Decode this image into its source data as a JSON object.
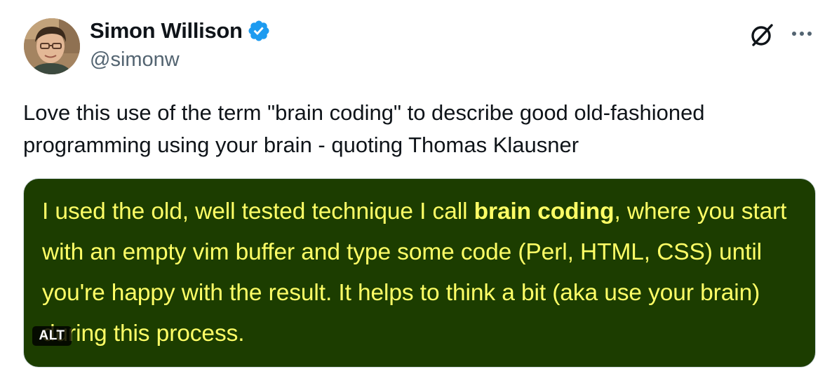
{
  "author": {
    "name": "Simon Willison",
    "handle": "@simonw",
    "verified": true
  },
  "icons": {
    "verified": "verified-badge-icon",
    "grok": "grok-icon",
    "more": "more-options-icon"
  },
  "colors": {
    "verified": "#1d9bf0",
    "quote_background": "#1c3d00",
    "quote_text": "#ffff66",
    "handle": "#536471"
  },
  "tweet": {
    "text_line1": "Love this use of the term \"brain coding\" to describe good old-fashioned",
    "text_line2": "programming using your brain - quoting Thomas Klausner"
  },
  "media": {
    "alt_label": "ALT",
    "quote_part1": "I used the old, well tested technique I call ",
    "quote_bold": "brain coding",
    "quote_part2": ", where you start with an empty vim buffer and type some code (Perl, HTML, CSS) until you're happy with the result. It helps to think a bit (aka use your brain) during this process."
  }
}
